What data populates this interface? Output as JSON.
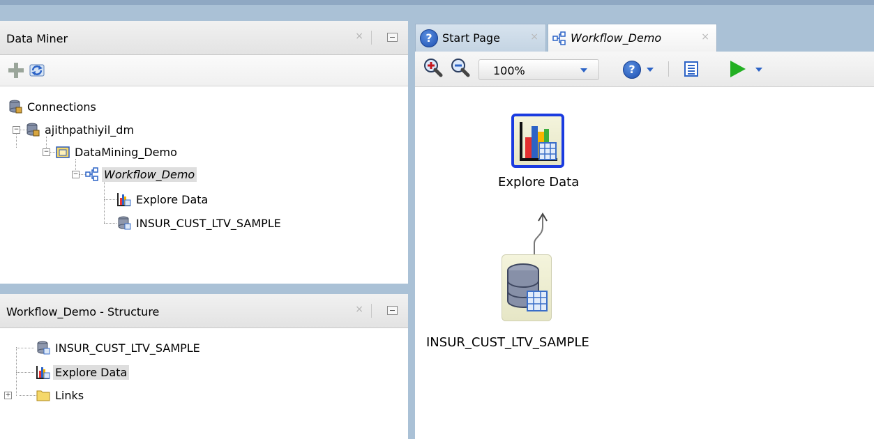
{
  "top_panel": {
    "title": "Data Miner",
    "close_glyph": "×",
    "toolbar": {
      "add_icon": "plus-icon",
      "refresh_icon": "refresh-icon"
    },
    "tree": {
      "root_label": "Connections",
      "connection_label": "ajithpathiyil_dm",
      "project_label": "DataMining_Demo",
      "workflow_label": "Workflow_Demo",
      "node1_label": "Explore Data",
      "node2_label": "INSUR_CUST_LTV_SAMPLE"
    }
  },
  "structure_panel": {
    "title": "Workflow_Demo - Structure",
    "close_glyph": "×",
    "items": {
      "source_label": "INSUR_CUST_LTV_SAMPLE",
      "explore_label": "Explore Data",
      "links_label": "Links"
    }
  },
  "tabs": {
    "start_label": "Start Page",
    "workflow_label": "Workflow_Demo",
    "close_glyph": "×",
    "help_glyph": "?"
  },
  "editor_toolbar": {
    "zoom_value": "100%",
    "help_glyph": "?"
  },
  "canvas": {
    "explore_label": "Explore Data",
    "source_label": "INSUR_CUST_LTV_SAMPLE"
  },
  "colors": {
    "accent_blue": "#2c63c6",
    "node_selected_border": "#1a3be0",
    "run_green": "#23b023",
    "frame": "#aac1d6"
  }
}
